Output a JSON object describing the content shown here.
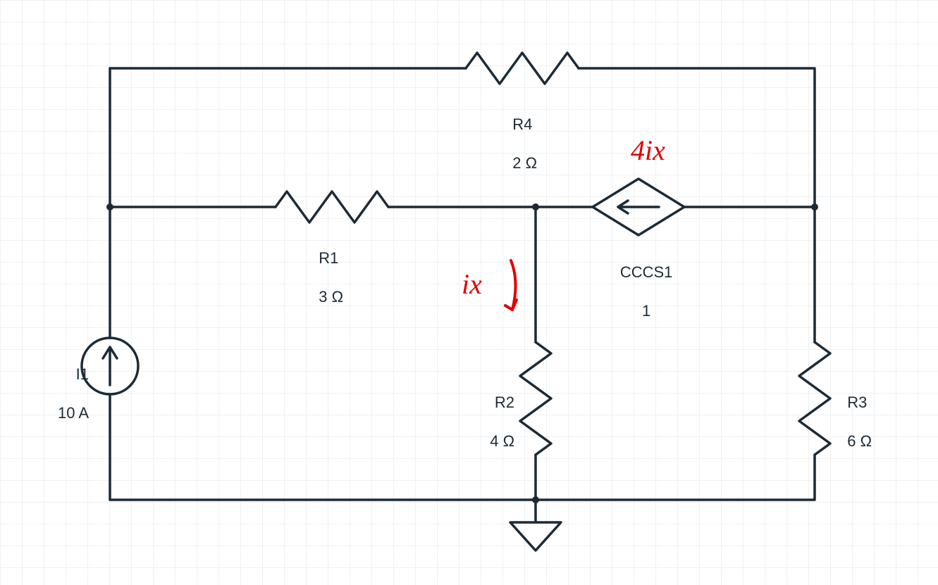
{
  "components": {
    "I1": {
      "name": "I1",
      "value": "10 A"
    },
    "R1": {
      "name": "R1",
      "value": "3 Ω"
    },
    "R2": {
      "name": "R2",
      "value": "4 Ω"
    },
    "R3": {
      "name": "R3",
      "value": "6 Ω"
    },
    "R4": {
      "name": "R4",
      "value": "2 Ω"
    },
    "CCCS1": {
      "name": "CCCS1",
      "value": "1"
    }
  },
  "annotations": {
    "gain": "4ix",
    "ix": "ix"
  }
}
